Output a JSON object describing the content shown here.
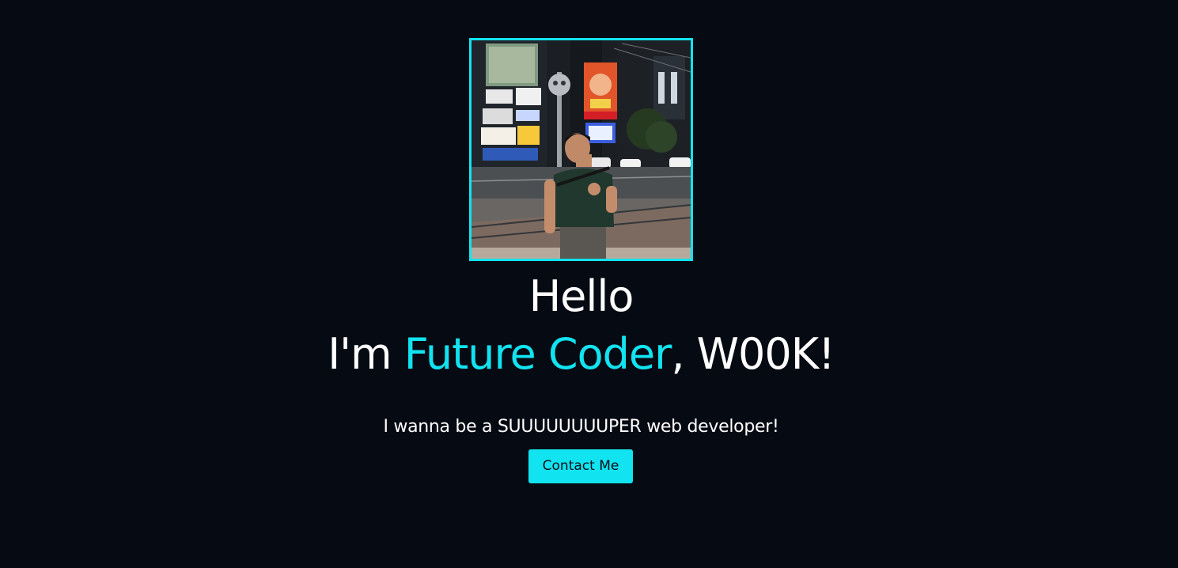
{
  "hero": {
    "photo_alt": "Profile photo of a person standing in a neon-lit city street at night",
    "hello": "Hello",
    "intro_prefix": "I'm ",
    "intro_highlight": "Future Coder",
    "intro_suffix": ", W00K!",
    "tagline": "I wanna be a SUUUUUUUUPER web developer!",
    "contact_label": "Contact Me"
  },
  "colors": {
    "background": "#060a13",
    "accent": "#12e3f0",
    "text": "#ffffff",
    "button_text": "#0a0f18"
  }
}
